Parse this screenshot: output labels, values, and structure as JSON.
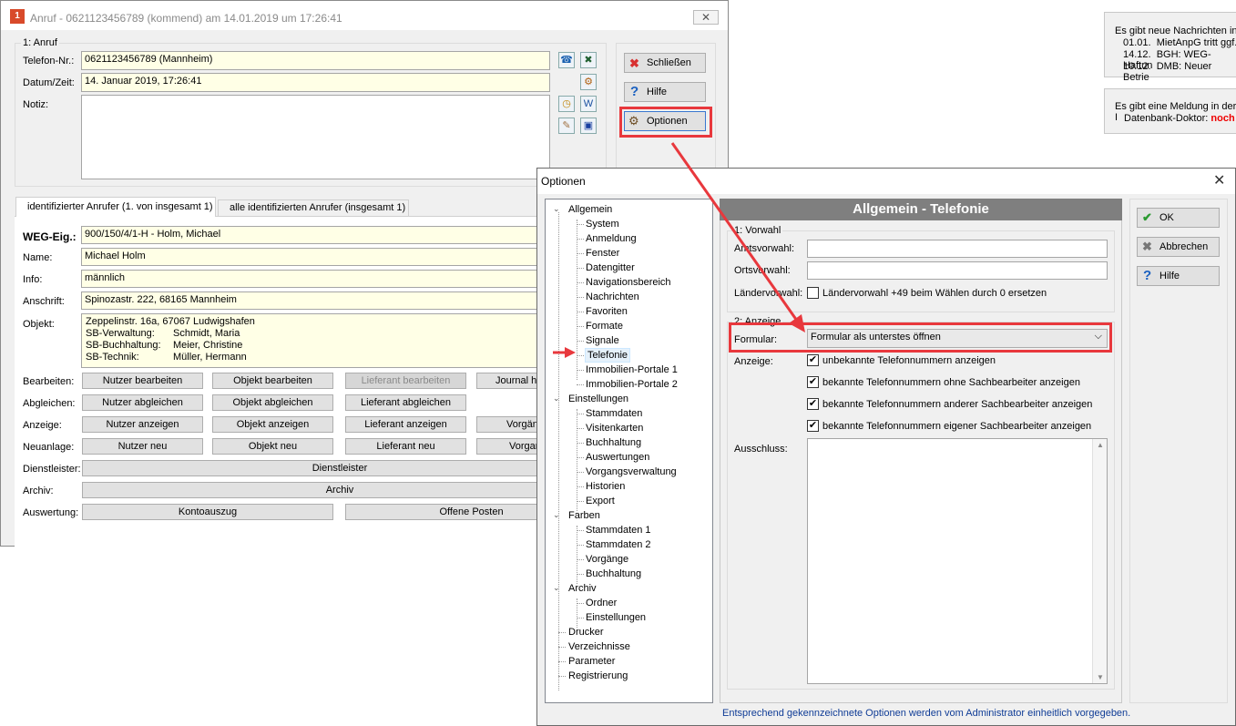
{
  "right_panel": {
    "news_line1": "Es gibt neue Nachrichten in",
    "news_items": [
      {
        "date": "01.01.",
        "text": "MietAnpG tritt ggf."
      },
      {
        "date": "14.12.",
        "text": "BGH: WEG-Haftun"
      },
      {
        "date": "10.12.",
        "text": "DMB: Neuer Betrie"
      }
    ],
    "msg_line1": "Es gibt eine Meldung in der I",
    "msg_prefix": "Datenbank-Doktor:",
    "msg_highlight": "noch"
  },
  "call_window": {
    "title": "Anruf - 0621123456789 (kommend) am 14.01.2019 um 17:26:41",
    "section_call": "1: Anruf",
    "phone_label": "Telefon-Nr.:",
    "phone_value": "0621123456789  (Mannheim)",
    "datetime_label": "Datum/Zeit:",
    "datetime_value": "14. Januar 2019,  17:26:41",
    "note_label": "Notiz:",
    "btn_close": "Schließen",
    "btn_help": "Hilfe",
    "btn_options": "Optionen",
    "tab_identified": "identifizierter Anrufer  (1. von insgesamt 1)",
    "tab_all": "alle identifizierten Anrufer (insgesamt 1)",
    "weg_label": "WEG-Eig.:",
    "weg_value": "900/150/4/1-H - Holm, Michael",
    "name_label": "Name:",
    "name_value": "Michael Holm",
    "info_label": "Info:",
    "info_value": "männlich",
    "address_label": "Anschrift:",
    "address_value": "Spinozastr. 222, 68165 Mannheim",
    "object_label": "Objekt:",
    "object_line1": "Zeppelinstr. 16a, 67067 Ludwigshafen",
    "object_rows": [
      {
        "k": "SB-Verwaltung:",
        "v": "Schmidt, Maria"
      },
      {
        "k": "SB-Buchhaltung:",
        "v": "Meier, Christine"
      },
      {
        "k": "SB-Technik:",
        "v": "Müller, Hermann"
      }
    ],
    "row_edit_label": "Bearbeiten:",
    "row_edit": [
      "Nutzer bearbeiten",
      "Objekt bearbeiten",
      "Lieferant bearbeiten",
      "Journal hi"
    ],
    "row_sync_label": "Abgleichen:",
    "row_sync": [
      "Nutzer abgleichen",
      "Objekt abgleichen",
      "Lieferant abgleichen"
    ],
    "row_show_label": "Anzeige:",
    "row_show": [
      "Nutzer anzeigen",
      "Objekt anzeigen",
      "Lieferant anzeigen",
      "Vorgän"
    ],
    "row_new_label": "Neuanlage:",
    "row_new": [
      "Nutzer neu",
      "Objekt neu",
      "Lieferant neu",
      "Vorgan"
    ],
    "provider_label": "Dienstleister:",
    "provider_btn": "Dienstleister",
    "archive_label": "Archiv:",
    "archive_btn": "Archiv",
    "eval_label": "Auswertung:",
    "eval_btns": [
      "Kontoauszug",
      "Offene Posten"
    ]
  },
  "options_dialog": {
    "title": "Optionen",
    "header": "Allgemein - Telefonie",
    "tree": {
      "allgemein": "Allgemein",
      "allgemein_children": [
        "System",
        "Anmeldung",
        "Fenster",
        "Datengitter",
        "Navigationsbereich",
        "Nachrichten",
        "Favoriten",
        "Formate",
        "Signale",
        "Telefonie",
        "Immobilien-Portale 1",
        "Immobilien-Portale 2"
      ],
      "einstellungen": "Einstellungen",
      "einstellungen_children": [
        "Stammdaten",
        "Visitenkarten",
        "Buchhaltung",
        "Auswertungen",
        "Vorgangsverwaltung",
        "Historien",
        "Export"
      ],
      "farben": "Farben",
      "farben_children": [
        "Stammdaten 1",
        "Stammdaten 2",
        "Vorgänge",
        "Buchhaltung"
      ],
      "archiv": "Archiv",
      "archiv_children": [
        "Ordner",
        "Einstellungen"
      ],
      "roots_tail": [
        "Drucker",
        "Verzeichnisse",
        "Parameter",
        "Registrierung"
      ]
    },
    "group_vorwahl": "1: Vorwahl",
    "amtsvorwahl_label": "Amtsvorwahl:",
    "amtsvorwahl_value": "",
    "ortsvorwahl_label": "Ortsvorwahl:",
    "ortsvorwahl_value": "",
    "laendervorwahl_label": "Ländervorwahl:",
    "laendervorwahl_cb": "Ländervorwahl +49 beim Wählen durch 0 ersetzen",
    "group_anzeige": "2: Anzeige",
    "formular_label": "Formular:",
    "formular_value": "Formular als unterstes öffnen",
    "anzeige_label": "Anzeige:",
    "anzeige_options": [
      "unbekannte Telefonnummern anzeigen",
      "bekannte Telefonnummern ohne Sachbearbeiter anzeigen",
      "bekannte Telefonnummern anderer Sachbearbeiter anzeigen",
      "bekannte Telefonnummern eigener Sachbearbeiter anzeigen"
    ],
    "ausschluss_label": "Ausschluss:",
    "btn_ok": "OK",
    "btn_cancel": "Abbrechen",
    "btn_help": "Hilfe",
    "footer": "Entsprechend gekennzeichnete Optionen werden vom Administrator einheitlich vorgegeben."
  },
  "colors": {
    "accent_red": "#e8383d",
    "header_gray": "#7f7f7f",
    "field_yellow": "#ffffe6",
    "footer_blue": "#0f3c96"
  }
}
